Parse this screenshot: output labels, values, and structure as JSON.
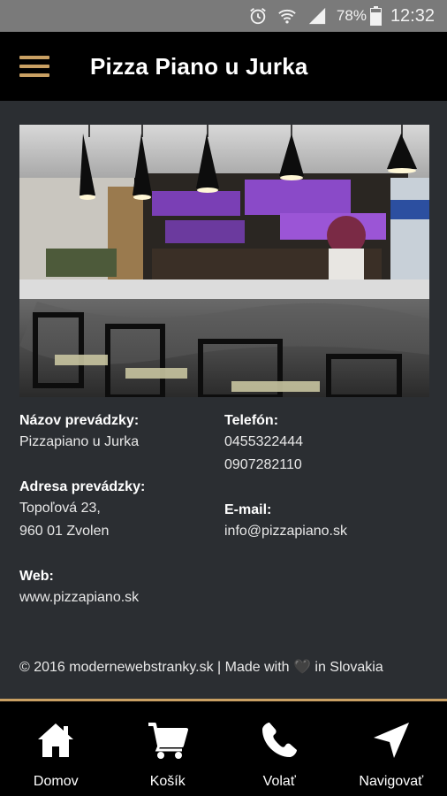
{
  "status_bar": {
    "battery": "78%",
    "time": "12:32"
  },
  "app_bar": {
    "title": "Pizza Piano u Jurka"
  },
  "hero": {
    "alt": "bar interior"
  },
  "info": {
    "name_label": "Názov prevádzky:",
    "name_value": "Pizzapiano u Jurka",
    "phone_label": "Telefón:",
    "phone_1": "0455322444",
    "phone_2": "0907282110",
    "address_label": "Adresa prevádzky:",
    "address_line1": "Topoľová 23,",
    "address_line2": "960 01 Zvolen",
    "email_label": "E-mail:",
    "email_value": "info@pizzapiano.sk",
    "web_label": "Web:",
    "web_value": "www.pizzapiano.sk"
  },
  "footer": {
    "text": "© 2016 modernewebstranky.sk | Made with 🖤 in Slovakia"
  },
  "bottom_nav": {
    "items": [
      {
        "label": "Domov",
        "icon": "home-icon"
      },
      {
        "label": "Košík",
        "icon": "cart-icon"
      },
      {
        "label": "Volať",
        "icon": "phone-icon"
      },
      {
        "label": "Navigovať",
        "icon": "navigation-icon"
      }
    ]
  },
  "colors": {
    "accent": "#c9a063",
    "background": "#2b2e32",
    "bar": "#000000",
    "status_bar": "#7a7a7a"
  }
}
